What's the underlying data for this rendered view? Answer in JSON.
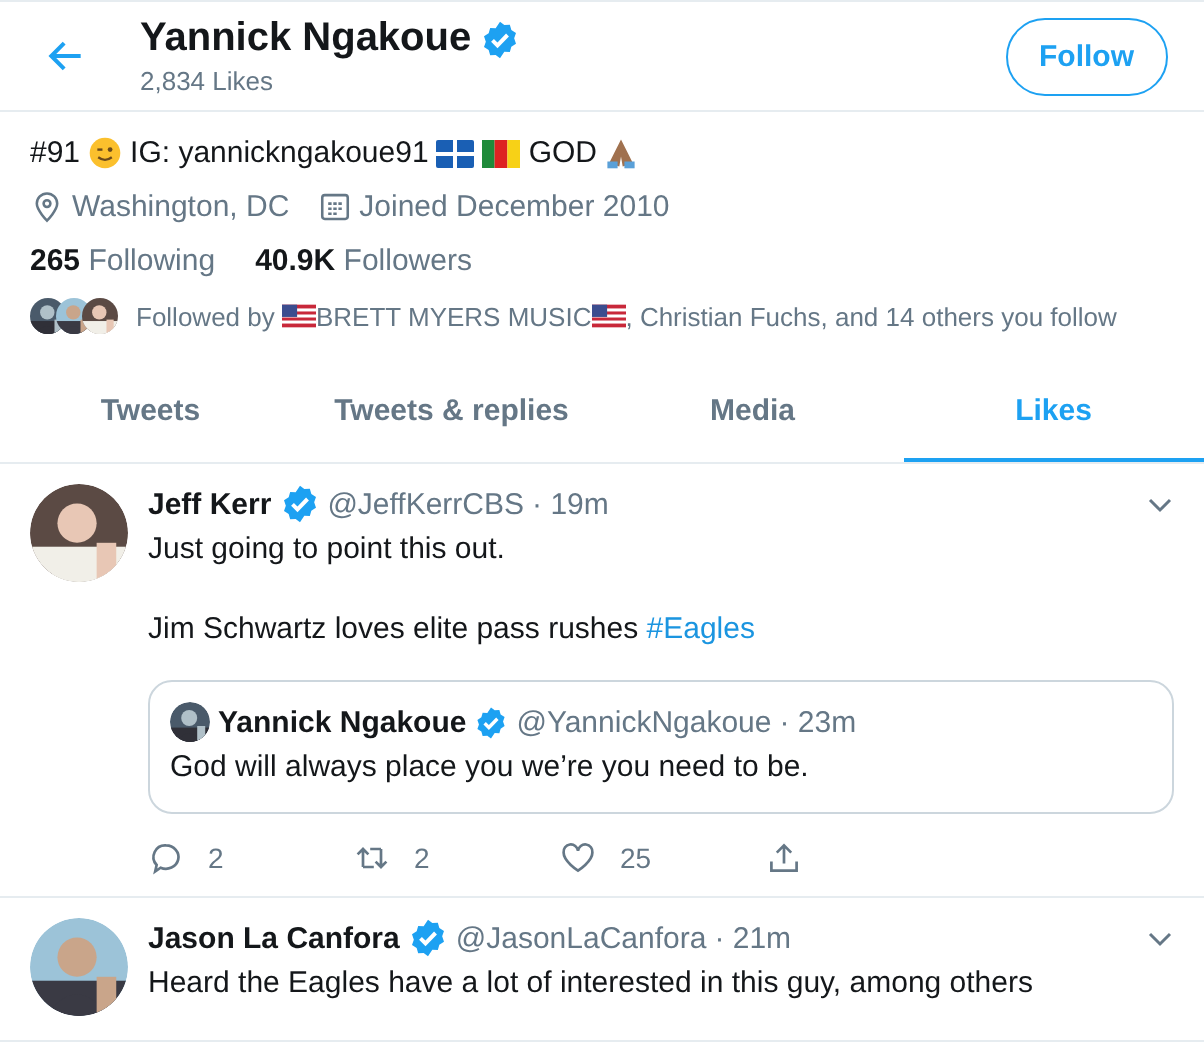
{
  "header": {
    "name": "Yannick Ngakoue",
    "verified": true,
    "likes_count": "2,834 Likes",
    "follow_button": "Follow"
  },
  "profile": {
    "bio": [
      "#91",
      "IG: yannickngakoue91",
      "GOD"
    ],
    "location": "Washington, DC",
    "joined": "Joined December 2010",
    "following_count": "265",
    "following_label": "Following",
    "followers_count": "40.9K",
    "followers_label": "Followers",
    "followed_by": [
      "Followed by",
      "BRETT MYERS MUSIC",
      ", Christian Fuchs, and 14 others you follow"
    ]
  },
  "tabs": [
    {
      "label": "Tweets",
      "selected": false
    },
    {
      "label": "Tweets & replies",
      "selected": false
    },
    {
      "label": "Media",
      "selected": false
    },
    {
      "label": "Likes",
      "selected": true
    }
  ],
  "tweets": [
    {
      "name": "Jeff Kerr",
      "verified": true,
      "handle": "@JeffKerrCBS",
      "time": "· 19m",
      "lines": [
        "Just going to point this out."
      ],
      "last_line": "Jim Schwartz loves elite pass rushes ",
      "hashtag": "#Eagles",
      "quote": {
        "name": "Yannick Ngakoue",
        "verified": true,
        "handle": "@YannickNgakoue",
        "time": "· 23m",
        "text": "God will always place you we’re you need to be."
      },
      "replies": "2",
      "retweets": "2",
      "likes": "25"
    },
    {
      "name": "Jason La Canfora",
      "verified": true,
      "handle": "@JasonLaCanfora",
      "time": "· 21m",
      "last_line": "Heard the Eagles have a lot of interested in this guy, among others"
    }
  ]
}
